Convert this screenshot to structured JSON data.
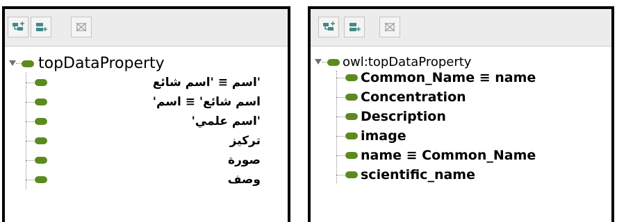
{
  "toolbar": {
    "buttons": [
      {
        "name": "add-subproperty",
        "icon": "add-subproperty-icon"
      },
      {
        "name": "add-sibling-property",
        "icon": "add-sibling-property-icon"
      },
      {
        "name": "delete-property",
        "icon": "delete-icon"
      }
    ]
  },
  "left_panel": {
    "root_label": "topDataProperty",
    "items": [
      {
        "label": "'اسم ≡ 'اسم شائع"
      },
      {
        "label": "اسم شائع' ≡ اسم'"
      },
      {
        "label": "'اسم علمي'"
      },
      {
        "label": "تركيز"
      },
      {
        "label": "صورة"
      },
      {
        "label": "وصف"
      }
    ]
  },
  "right_panel": {
    "root_label": "owl:topDataProperty",
    "items": [
      {
        "label": "Common_Name ≡ name"
      },
      {
        "label": "Concentration"
      },
      {
        "label": "Description"
      },
      {
        "label": "image"
      },
      {
        "label": "name ≡ Common_Name"
      },
      {
        "label": "scientific_name"
      }
    ]
  },
  "colors": {
    "data_property": "#5c8a1f",
    "toolbar_bg": "#ececec",
    "toolbar_icon": "#3e8a86",
    "delete_icon": "#a0a0a0",
    "panel_border": "#000000"
  }
}
